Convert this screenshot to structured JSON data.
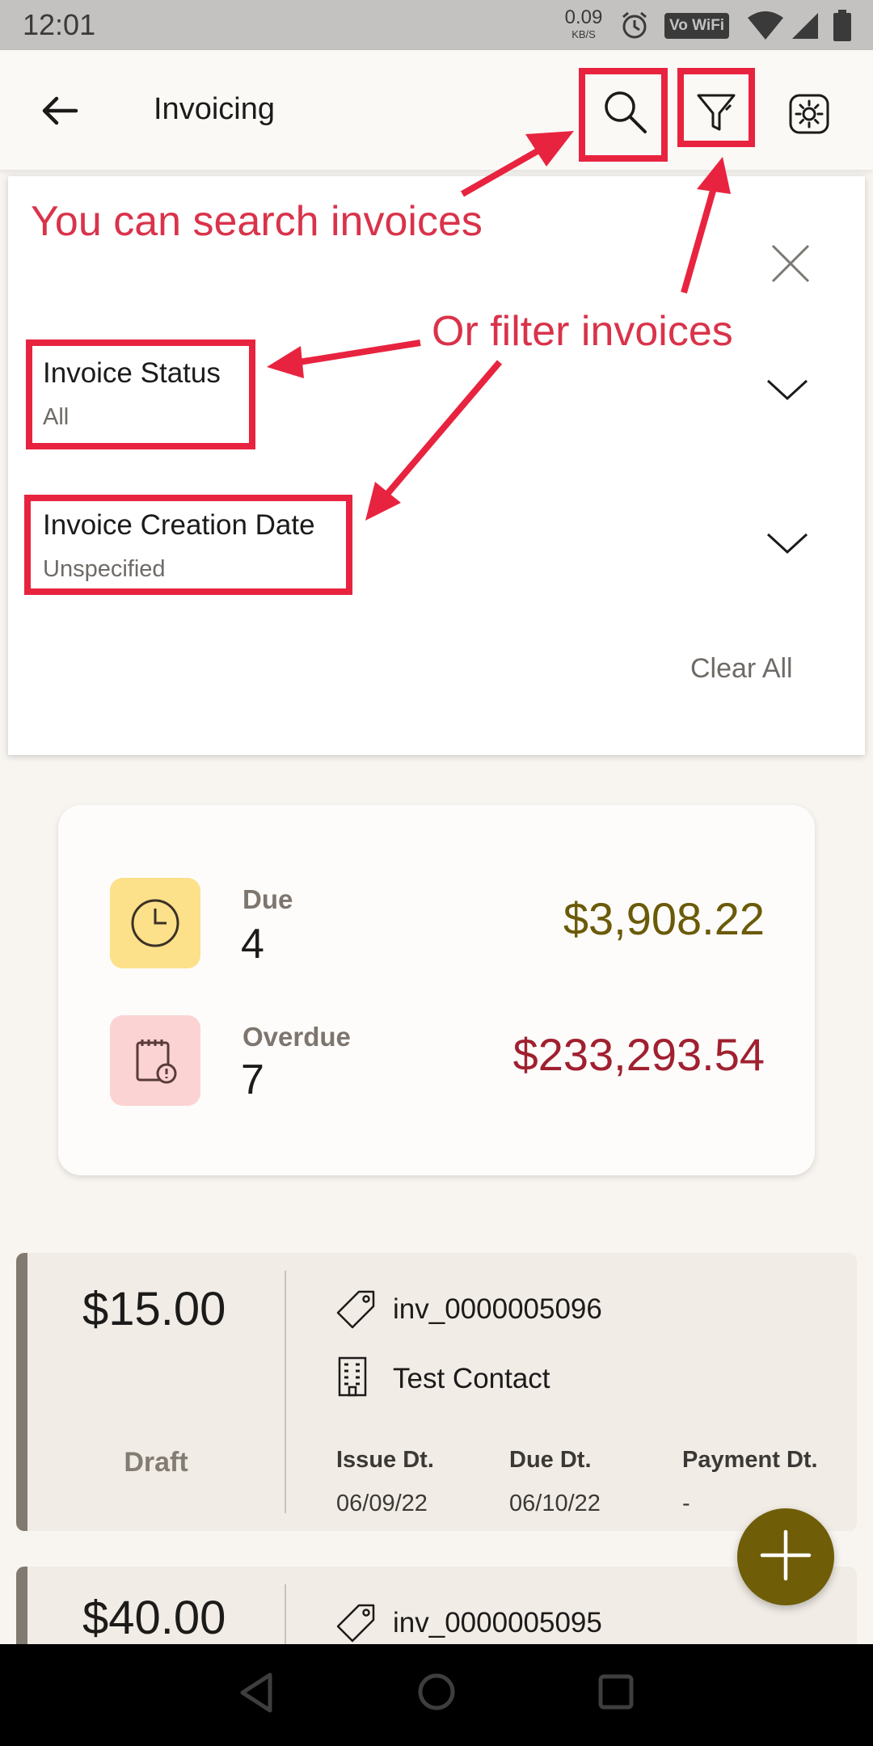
{
  "status_bar": {
    "time": "12:01",
    "net_speed_value": "0.09",
    "net_speed_unit": "KB/S",
    "wifi_badge": "Vo WiFi"
  },
  "app_bar": {
    "title": "Invoicing"
  },
  "annotations": {
    "search_note": "You can search invoices",
    "filter_note": "Or filter invoices"
  },
  "filters": {
    "status": {
      "label": "Invoice Status",
      "value": "All"
    },
    "creation_date": {
      "label": "Invoice Creation Date",
      "value": "Unspecified"
    },
    "clear_all": "Clear All"
  },
  "summary": {
    "due": {
      "label": "Due",
      "count": "4",
      "amount": "$3,908.22",
      "color": "#6b5a08"
    },
    "overdue": {
      "label": "Overdue",
      "count": "7",
      "amount": "$233,293.54",
      "color": "#a02030"
    }
  },
  "invoices": [
    {
      "amount": "$15.00",
      "status": "Draft",
      "number": "inv_0000005096",
      "contact": "Test Contact",
      "issue_label": "Issue Dt.",
      "issue_date": "06/09/22",
      "due_label": "Due Dt.",
      "due_date": "06/10/22",
      "payment_label": "Payment Dt.",
      "payment_date": "-"
    },
    {
      "amount": "$40.00",
      "number": "inv_0000005095"
    }
  ],
  "colors": {
    "accent": "#6f5d08",
    "annotation": "#e8233f",
    "due_bg": "#fde08a",
    "overdue_bg": "#fbd3d3"
  }
}
